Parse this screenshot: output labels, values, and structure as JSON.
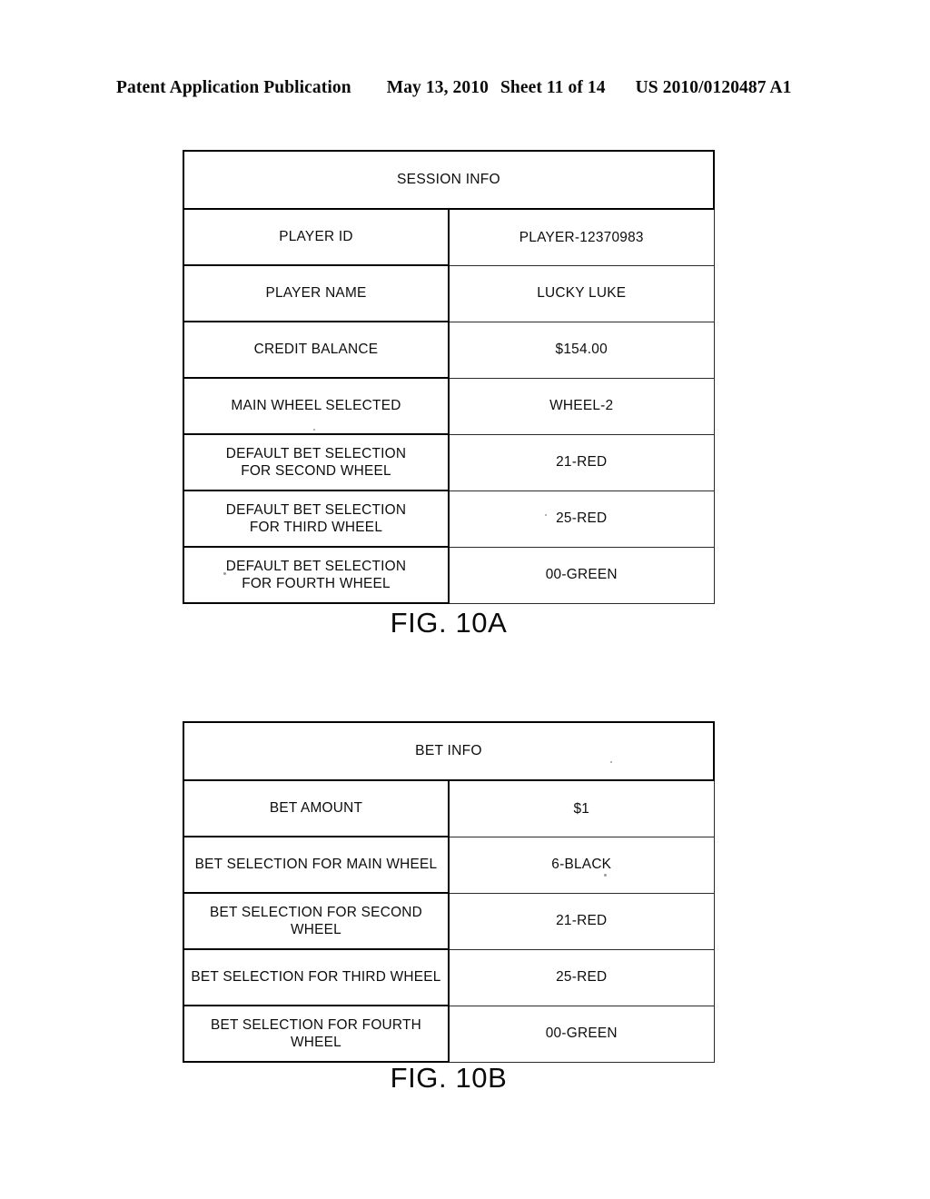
{
  "header": {
    "publication": "Patent Application Publication",
    "date": "May 13, 2010",
    "sheet": "Sheet 11 of 14",
    "doc_number": "US 2010/0120487 A1"
  },
  "figures": [
    {
      "id": "10A",
      "caption": "FIG. 10A",
      "title": "SESSION INFO",
      "rows": [
        {
          "label_line1": "PLAYER ID",
          "label_line2": "",
          "value": "PLAYER-12370983"
        },
        {
          "label_line1": "PLAYER NAME",
          "label_line2": "",
          "value": "LUCKY LUKE"
        },
        {
          "label_line1": "CREDIT BALANCE",
          "label_line2": "",
          "value": "$154.00"
        },
        {
          "label_line1": "MAIN WHEEL SELECTED",
          "label_line2": "",
          "value": "WHEEL-2"
        },
        {
          "label_line1": "DEFAULT BET SELECTION",
          "label_line2": "FOR SECOND WHEEL",
          "value": "21-RED"
        },
        {
          "label_line1": "DEFAULT BET SELECTION",
          "label_line2": "FOR THIRD WHEEL",
          "value": "25-RED"
        },
        {
          "label_line1": "DEFAULT BET SELECTION",
          "label_line2": "FOR FOURTH WHEEL",
          "value": "00-GREEN"
        }
      ]
    },
    {
      "id": "10B",
      "caption": "FIG. 10B",
      "title": "BET INFO",
      "rows": [
        {
          "label_line1": "BET AMOUNT",
          "label_line2": "",
          "value": "$1"
        },
        {
          "label_line1": "BET SELECTION FOR MAIN WHEEL",
          "label_line2": "",
          "value": "6-BLACK"
        },
        {
          "label_line1": "BET SELECTION FOR SECOND WHEEL",
          "label_line2": "",
          "value": "21-RED"
        },
        {
          "label_line1": "BET SELECTION  FOR THIRD WHEEL",
          "label_line2": "",
          "value": "25-RED"
        },
        {
          "label_line1": "BET SELECTION FOR FOURTH WHEEL",
          "label_line2": "",
          "value": "00-GREEN"
        }
      ]
    }
  ],
  "colors": {
    "page_background": "#ffffff",
    "ink": "#000000",
    "rule_light": "#2b2b2b"
  }
}
